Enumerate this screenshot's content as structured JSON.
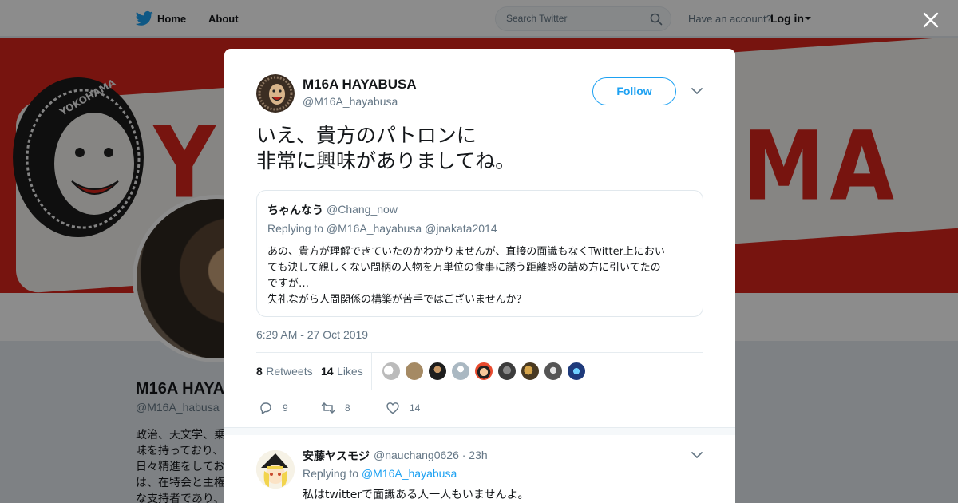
{
  "nav": {
    "home": "Home",
    "about": "About",
    "search_placeholder": "Search Twitter",
    "have_account": "Have an account?",
    "login": "Log in"
  },
  "profile": {
    "name": "M16A HAYA",
    "handle": "@M16A_habusa",
    "bio_lines": [
      "政治、天文学、乗",
      "味を持っており、",
      "日々精進をしてお",
      "は、在特会と主権",
      "な支持者であり、"
    ]
  },
  "banner": {
    "word": "MA",
    "tire_brand": "YOKOHAMA",
    "letter": "Y"
  },
  "tweet": {
    "author_name": "M16A HAYABUSA",
    "author_handle": "@M16A_hayabusa",
    "follow_label": "Follow",
    "text_lines": [
      "いえ、貴方のパトロンに",
      "非常に興味がありましてね。"
    ],
    "time": "6:29 AM - 27 Oct 2019",
    "retweets": "8",
    "retweets_label": "Retweets",
    "likes": "14",
    "likes_label": "Likes",
    "action_reply_count": "9",
    "action_retweet_count": "8",
    "action_like_count": "14"
  },
  "quote": {
    "name": "ちゃんなう",
    "handle": "@Chang_now",
    "replying_to": "Replying to @M16A_hayabusa @jnakata2014",
    "body_lines": [
      "あの、貴方が理解できていたのかわかりませんが、直接の面識もなくTwitter上におい",
      "ても決して親しくない間柄の人物を万単位の食事に誘う距離感の詰め方に引いてたの",
      "ですが…",
      "失礼ながら人間関係の構築が苦手ではございませんか？"
    ]
  },
  "reply": {
    "name": "安藤ヤスモジ",
    "handle": "@nauchang0626",
    "time": "· 23h",
    "replying_prefix": "Replying to",
    "replying_handle": "@M16A_hayabusa",
    "body": "私はtwitterで面識ある人一人もいませんよ。"
  },
  "colors": {
    "accent": "#1da1f2",
    "banner_red": "#d9261c",
    "text_secondary": "#657786"
  }
}
